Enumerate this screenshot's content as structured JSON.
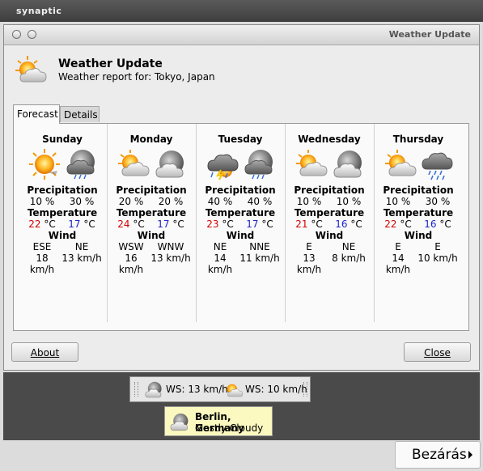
{
  "outer_window": {
    "title": "synaptic"
  },
  "dialog": {
    "title": "Weather Update",
    "header_title": "Weather Update",
    "header_subtitle": "Weather report for: Tokyo, Japan",
    "tabs": [
      {
        "label": "Forecast",
        "active": true
      },
      {
        "label": "Details",
        "active": false
      }
    ],
    "labels": {
      "precipitation": "Precipitation",
      "temperature": "Temperature",
      "wind": "Wind"
    },
    "temp_unit": "°C",
    "days": [
      {
        "name": "Sunday",
        "icons": [
          "sunny-icon",
          "rain-night-icon"
        ],
        "precip": [
          "10 %",
          "30 %"
        ],
        "temp_high": "22",
        "temp_low": "17",
        "wind_dir": [
          "ESE",
          "NE"
        ],
        "wind_speed": [
          "18 km/h",
          "13 km/h"
        ]
      },
      {
        "name": "Monday",
        "icons": [
          "partly-cloudy-icon",
          "cloudy-night-icon"
        ],
        "precip": [
          "20 %",
          "20 %"
        ],
        "temp_high": "24",
        "temp_low": "17",
        "wind_dir": [
          "WSW",
          "WNW"
        ],
        "wind_speed": [
          "16 km/h",
          "13 km/h"
        ]
      },
      {
        "name": "Tuesday",
        "icons": [
          "thunderstorm-icon",
          "rain-night-icon"
        ],
        "precip": [
          "40 %",
          "40 %"
        ],
        "temp_high": "23",
        "temp_low": "17",
        "wind_dir": [
          "NE",
          "NNE"
        ],
        "wind_speed": [
          "14 km/h",
          "11 km/h"
        ]
      },
      {
        "name": "Wednesday",
        "icons": [
          "partly-cloudy-icon",
          "cloudy-night-icon"
        ],
        "precip": [
          "10 %",
          "10 %"
        ],
        "temp_high": "21",
        "temp_low": "16",
        "wind_dir": [
          "E",
          "NE"
        ],
        "wind_speed": [
          "13 km/h",
          "8 km/h"
        ]
      },
      {
        "name": "Thursday",
        "icons": [
          "partly-cloudy-icon",
          "showers-icon"
        ],
        "precip": [
          "10 %",
          "30 %"
        ],
        "temp_high": "22",
        "temp_low": "16",
        "wind_dir": [
          "E",
          "E"
        ],
        "wind_speed": [
          "14 km/h",
          "10 km/h"
        ]
      }
    ],
    "buttons": {
      "about": "About",
      "close": "Close"
    }
  },
  "applet": {
    "items": [
      {
        "text": "WS: 13 km/h",
        "icon": "cloudy-night-icon"
      },
      {
        "text": "WS: 10 km/h",
        "icon": "partly-cloudy-icon"
      }
    ]
  },
  "tooltip": {
    "city": "Berlin, Germany",
    "condition": "Mostly Cloudy"
  },
  "bottom_button": {
    "label": "Bezárás"
  },
  "colors": {
    "high_temp": "#d40000",
    "low_temp": "#1c26c8",
    "tooltip_bg": "#fbf8c0"
  }
}
